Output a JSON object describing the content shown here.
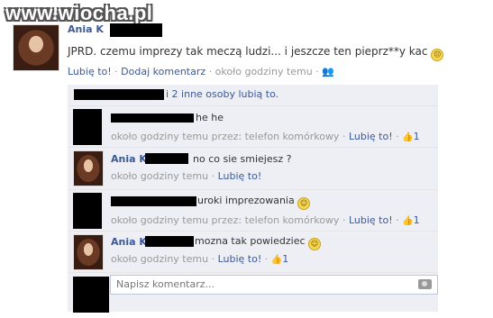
{
  "watermark": "www.wiocha.pl",
  "post": {
    "author": "Ania K",
    "text": "JPRD. czemu imprezy tak meczą ludzi... i jeszcze ten pieprz**y kac",
    "like": "Lubię to!",
    "comment": "Dodaj komentarz",
    "time": "około godziny temu"
  },
  "likes": {
    "text": "i 2 inne osoby lubią to."
  },
  "comments": [
    {
      "text": "he he",
      "meta": "około godziny temu przez: telefon komórkowy",
      "like": "Lubię to!",
      "count": "1"
    },
    {
      "author": "Ania K",
      "text": "no co sie smiejesz ?",
      "meta": "około godziny temu",
      "like": "Lubię to!"
    },
    {
      "text": "uroki imprezowania",
      "meta": "około godziny temu przez: telefon komórkowy",
      "like": "Lubię to!",
      "count": "1"
    },
    {
      "author": "Ania K",
      "text": "mozna tak powiedziec",
      "meta": "około godziny temu",
      "like": "Lubię to!",
      "count": "1"
    }
  ],
  "composer": {
    "placeholder": "Napisz komentarz..."
  },
  "separator": "·",
  "icons": {
    "smiley": "smiley-icon",
    "thumb": "thumbs-up-icon",
    "camera": "camera-icon",
    "people": "people-icon"
  }
}
